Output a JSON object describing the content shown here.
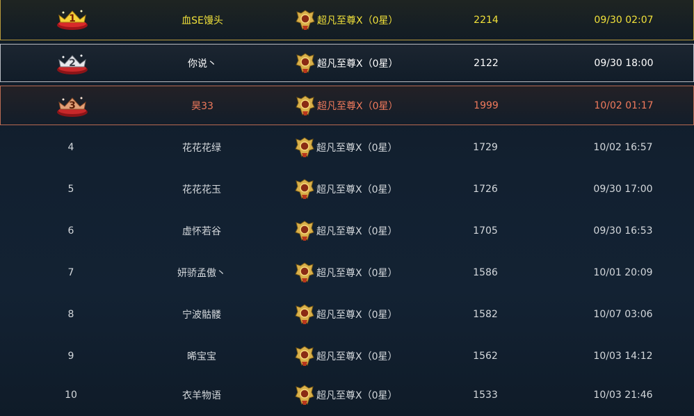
{
  "rows": [
    {
      "rank": "1",
      "name": "血SE馒头",
      "tier": "超凡至尊Ⅹ（0星）",
      "score": "2214",
      "time": "09/30 02:07"
    },
    {
      "rank": "2",
      "name": "你说丶",
      "tier": "超凡至尊Ⅹ（0星）",
      "score": "2122",
      "time": "09/30 18:00"
    },
    {
      "rank": "3",
      "name": "昊33",
      "tier": "超凡至尊Ⅹ（0星）",
      "score": "1999",
      "time": "10/02 01:17"
    },
    {
      "rank": "4",
      "name": "花花花绿",
      "tier": "超凡至尊Ⅹ（0星）",
      "score": "1729",
      "time": "10/02 16:57"
    },
    {
      "rank": "5",
      "name": "花花花玉",
      "tier": "超凡至尊Ⅹ（0星）",
      "score": "1726",
      "time": "09/30 17:00"
    },
    {
      "rank": "6",
      "name": "虚怀若谷",
      "tier": "超凡至尊Ⅹ（0星）",
      "score": "1705",
      "time": "09/30 16:53"
    },
    {
      "rank": "7",
      "name": "妍骄孟傲丶",
      "tier": "超凡至尊Ⅹ（0星）",
      "score": "1586",
      "time": "10/01 20:09"
    },
    {
      "rank": "8",
      "name": "宁波骷髅",
      "tier": "超凡至尊Ⅹ（0星）",
      "score": "1582",
      "time": "10/07 03:06"
    },
    {
      "rank": "9",
      "name": "晞宝宝",
      "tier": "超凡至尊Ⅹ（0星）",
      "score": "1562",
      "time": "10/03 14:12"
    },
    {
      "rank": "10",
      "name": "衣羊物语",
      "tier": "超凡至尊Ⅹ（0星）",
      "score": "1533",
      "time": "10/03 21:46"
    }
  ],
  "icons": {
    "medal_1": "gold-medal-icon",
    "medal_2": "silver-medal-icon",
    "medal_3": "bronze-medal-icon",
    "tier": "tier-emblem-icon"
  },
  "colors": {
    "gold": "#f1e13a",
    "silver": "#ffffff",
    "bronze": "#f07a5c",
    "normal": "#d4d8dc"
  }
}
